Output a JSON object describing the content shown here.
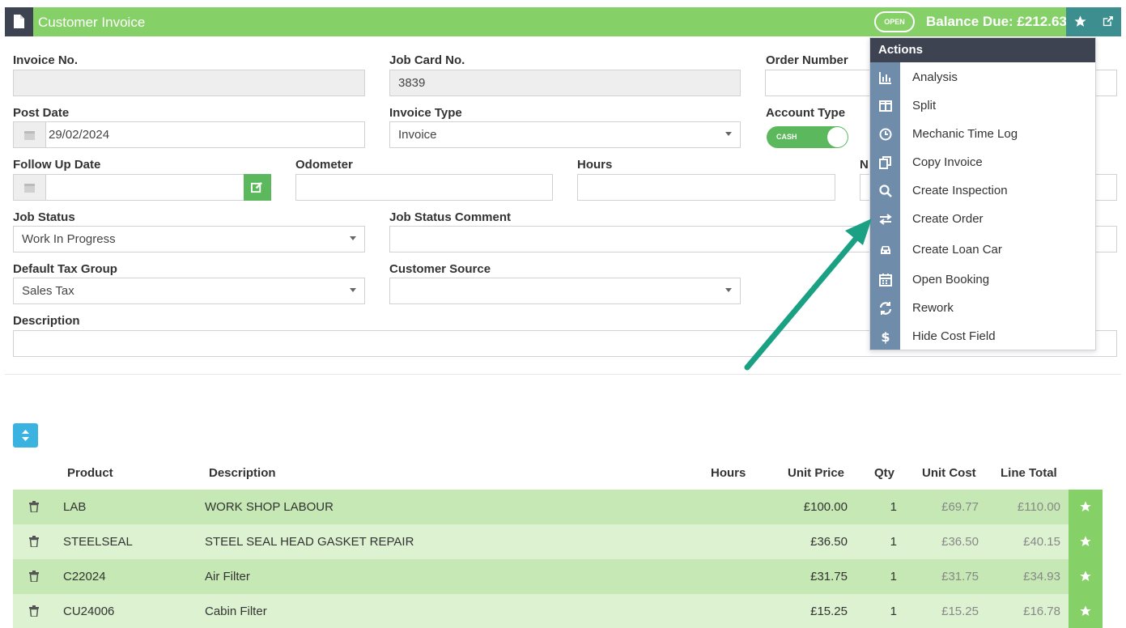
{
  "header": {
    "title": "Customer Invoice",
    "status": "OPEN",
    "balance": "Balance Due: £212.63"
  },
  "form": {
    "invoice_no": {
      "label": "Invoice No.",
      "value": ""
    },
    "job_card_no": {
      "label": "Job Card No.",
      "value": "3839"
    },
    "order_number": {
      "label": "Order Number",
      "value": ""
    },
    "post_date": {
      "label": "Post Date",
      "value": "29/02/2024"
    },
    "invoice_type": {
      "label": "Invoice Type",
      "value": "Invoice"
    },
    "account_type": {
      "label": "Account Type",
      "value": "CASH"
    },
    "follow_up_date": {
      "label": "Follow Up Date",
      "value": ""
    },
    "odometer": {
      "label": "Odometer",
      "value": ""
    },
    "hours": {
      "label": "Hours",
      "value": ""
    },
    "next_label_fragment": "N",
    "job_status": {
      "label": "Job Status",
      "value": "Work In Progress"
    },
    "job_status_comment": {
      "label": "Job Status Comment",
      "value": ""
    },
    "default_tax_group": {
      "label": "Default Tax Group",
      "value": "Sales Tax"
    },
    "customer_source": {
      "label": "Customer Source",
      "value": ""
    },
    "description": {
      "label": "Description",
      "value": ""
    }
  },
  "table": {
    "headers": {
      "product": "Product",
      "description": "Description",
      "hours": "Hours",
      "unit_price": "Unit Price",
      "qty": "Qty",
      "unit_cost": "Unit Cost",
      "line_total": "Line Total"
    },
    "rows": [
      {
        "product": "LAB",
        "description": "WORK SHOP LABOUR",
        "hours": "",
        "unit_price": "£100.00",
        "qty": "1",
        "unit_cost": "£69.77",
        "line_total": "£110.00"
      },
      {
        "product": "STEELSEAL",
        "description": "STEEL SEAL HEAD GASKET REPAIR",
        "hours": "",
        "unit_price": "£36.50",
        "qty": "1",
        "unit_cost": "£36.50",
        "line_total": "£40.15"
      },
      {
        "product": "C22024",
        "description": "Air Filter",
        "hours": "",
        "unit_price": "£31.75",
        "qty": "1",
        "unit_cost": "£31.75",
        "line_total": "£34.93"
      },
      {
        "product": "CU24006",
        "description": "Cabin Filter",
        "hours": "",
        "unit_price": "£15.25",
        "qty": "1",
        "unit_cost": "£15.25",
        "line_total": "£16.78"
      }
    ]
  },
  "actions_menu": {
    "title": "Actions",
    "items": [
      {
        "label": "Analysis",
        "icon": "bar-chart-icon"
      },
      {
        "label": "Split",
        "icon": "columns-icon"
      },
      {
        "label": "Mechanic Time Log",
        "icon": "clock-icon"
      },
      {
        "label": "Copy Invoice",
        "icon": "copy-icon"
      },
      {
        "label": "Create Inspection",
        "icon": "search-icon"
      },
      {
        "label": "Create Order",
        "icon": "exchange-icon"
      },
      {
        "label": "Create Loan Car",
        "icon": "car-icon"
      },
      {
        "label": "Open Booking",
        "icon": "calendar-icon"
      },
      {
        "label": "Rework",
        "icon": "refresh-icon"
      },
      {
        "label": "Hide Cost Field",
        "icon": "dollar-icon"
      }
    ]
  },
  "colors": {
    "header_green": "#86d167",
    "dark_slate": "#3d4350",
    "teal": "#3d8e8f",
    "row_green_dark": "#c5e8b4",
    "row_green_light": "#dcf2d1",
    "menu_strip": "#6f8dab",
    "arrow": "#1aa083"
  }
}
